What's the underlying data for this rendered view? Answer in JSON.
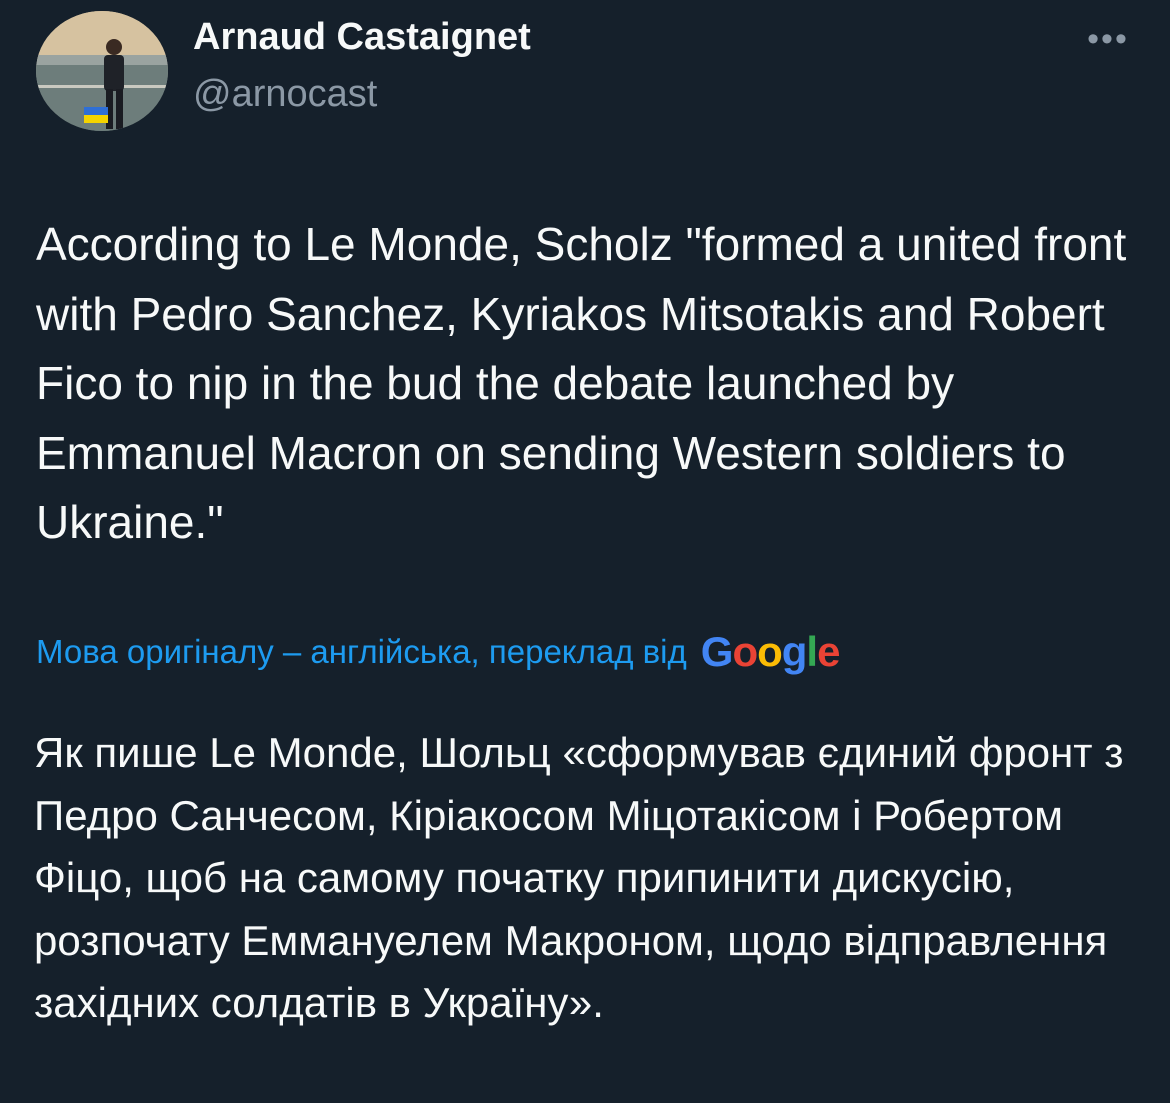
{
  "author": {
    "name": "Arnaud Castaignet",
    "handle": "@arnocast"
  },
  "icons": {
    "avatar": "profile-photo",
    "more": "more-horizontal-icon"
  },
  "more_glyph": "•••",
  "tweet": {
    "text": "According to Le Monde, Scholz \"formed a united front with Pedro Sanchez, Kyriakos Mitsotakis and Robert Fico to nip in the bud the debate launched by Emmanuel Macron on sending Western soldiers to Ukraine.\""
  },
  "translation": {
    "label": "Мова оригіналу – англійська, переклад від",
    "provider_letters": [
      "G",
      "o",
      "o",
      "g",
      "l",
      "e"
    ],
    "provider_colors": [
      "#4285f4",
      "#ea4335",
      "#fbbc05",
      "#4285f4",
      "#34a853",
      "#ea4335"
    ],
    "text": "Як пише Le Monde, Шольц «сформував єдиний фронт з Педро Санчесом, Кіріакосом Міцотакісом і Робертом Фіцо, щоб на самому початку припинити дискусію, розпочату Еммануелем Макроном, щодо відправлення західних солдатів в Україну»."
  },
  "colors": {
    "background": "#15202b",
    "text_primary": "#f7f9f9",
    "text_secondary": "#8b98a5",
    "link": "#1d9bf0"
  }
}
